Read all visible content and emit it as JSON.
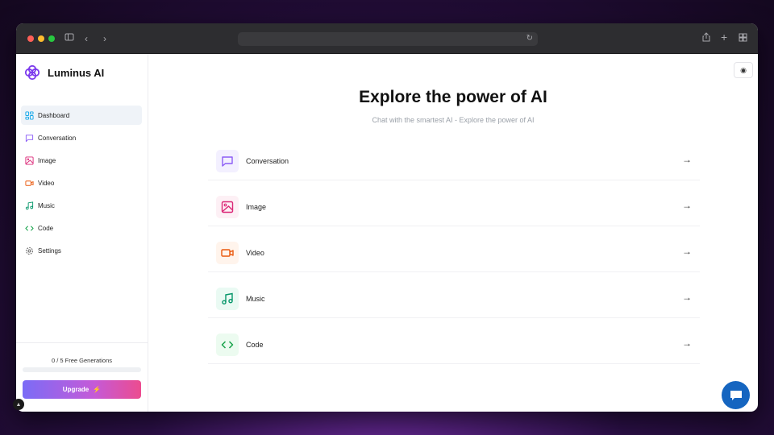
{
  "app": {
    "name": "Luminus AI"
  },
  "sidebar": {
    "items": [
      {
        "label": "Dashboard",
        "icon": "dashboard-icon",
        "color": "#0ea5e9",
        "active": true
      },
      {
        "label": "Conversation",
        "icon": "message-square-icon",
        "color": "#8b5cf6"
      },
      {
        "label": "Image",
        "icon": "image-icon",
        "color": "#db2777"
      },
      {
        "label": "Video",
        "icon": "video-icon",
        "color": "#ea580c"
      },
      {
        "label": "Music",
        "icon": "music-icon",
        "color": "#059669"
      },
      {
        "label": "Code",
        "icon": "code-icon",
        "color": "#16a34a"
      },
      {
        "label": "Settings",
        "icon": "settings-icon",
        "color": "#555555"
      }
    ],
    "credits_text": "0 / 5 Free Generations",
    "upgrade_label": "Upgrade"
  },
  "main": {
    "title": "Explore the power of AI",
    "subtitle": "Chat with the smartest AI - Explore the power of AI",
    "tools": [
      {
        "label": "Conversation",
        "icon": "message-square-icon",
        "color": "#8b5cf6",
        "bg": "#f3f0ff"
      },
      {
        "label": "Image",
        "icon": "image-icon",
        "color": "#db2777",
        "bg": "#fdf0f5"
      },
      {
        "label": "Video",
        "icon": "video-icon",
        "color": "#ea580c",
        "bg": "#fff4ec"
      },
      {
        "label": "Music",
        "icon": "music-icon",
        "color": "#059669",
        "bg": "#eafaf3"
      },
      {
        "label": "Code",
        "icon": "code-icon",
        "color": "#16a34a",
        "bg": "#ecfbf0"
      }
    ]
  },
  "colors": {
    "accent_start": "#7b6cf6",
    "accent_end": "#ec4c8f",
    "chat_button": "#1565c0"
  }
}
